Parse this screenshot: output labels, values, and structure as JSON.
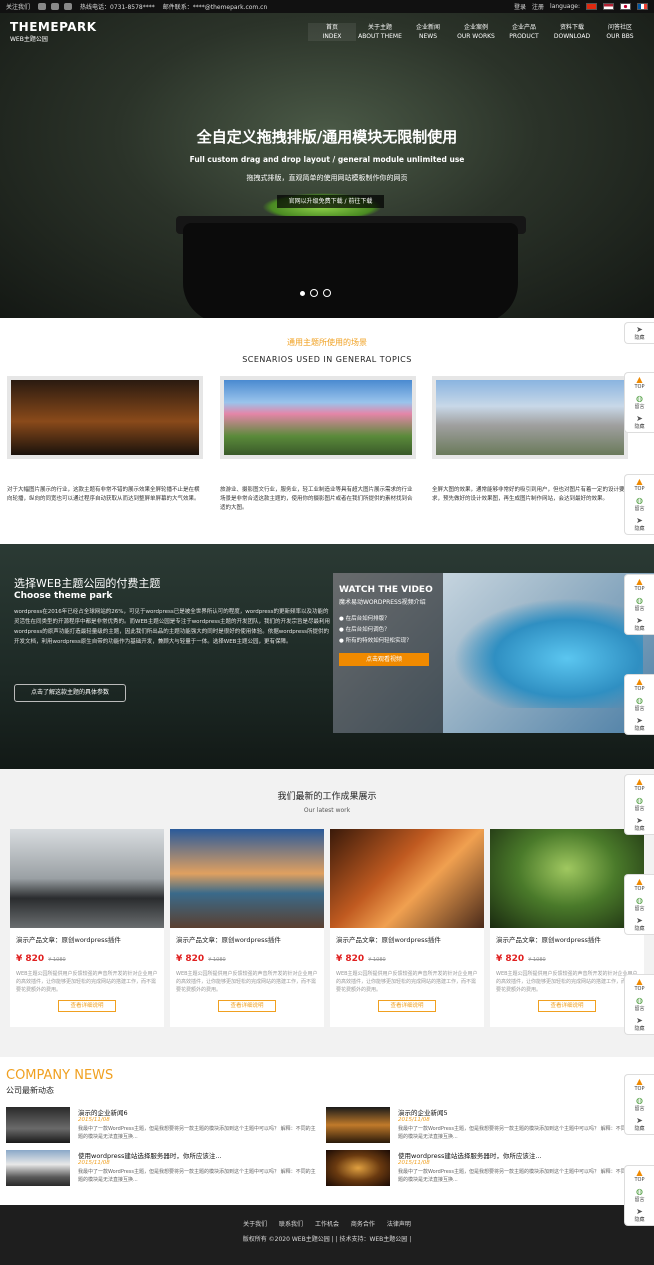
{
  "topbar": {
    "follow": "关注我们",
    "hotline": "热线电话：0731-8578****",
    "email": "邮件联系：****@themepark.com.cn",
    "login": "登录",
    "register": "注册",
    "language": "language:"
  },
  "header": {
    "logo_main": "THEMEPARK",
    "logo_sub": "WEB主题公园",
    "nav": [
      {
        "cn": "首页",
        "en": "INDEX"
      },
      {
        "cn": "关于主题",
        "en": "ABOUT THEME"
      },
      {
        "cn": "企业新闻",
        "en": "NEWS"
      },
      {
        "cn": "企业案例",
        "en": "OUR WORKS"
      },
      {
        "cn": "企业产品",
        "en": "PRODUCT"
      },
      {
        "cn": "资料下载",
        "en": "DOWNLOAD"
      },
      {
        "cn": "问答社区",
        "en": "OUR BBS"
      }
    ]
  },
  "hero": {
    "title": "全自定义拖拽排版/通用模块无限制使用",
    "subtitle_en": "Full custom drag and drop layout / general module unlimited use",
    "subtitle_cn": "拖拽式排版，直观简单的使用网站模板制作你的网页",
    "button": "官网以升级免费下载 / 前往下载"
  },
  "scenarios": {
    "title": "通用主题所使用的场景",
    "subtitle": "SCENARIOS USED IN GENERAL TOPICS",
    "cards": [
      {
        "text": "对于大幅图片展示的行业，这款主题有非常不错的展示效果全屏轮播不止是在横向轮播，纵向的同宽也可以通过程序自动获取从而达到整屏单屏幕的大气效果。"
      },
      {
        "text": "旅游业、摄影图文行业，服务业，轻工业制造业等具有超大图片展示需求的行业场景是非常合适这款主题的，使用你的摄影图片或者在我们所提供的素材找到合适的大图。"
      },
      {
        "text": "全屏大图的效果，通常能够非常好的吸引到用户，但也对图片有着一定的设计要求，预先做好的设计效果图，再生成图片制作网站，会达到最好的效果。"
      }
    ]
  },
  "choose": {
    "title": "选择WEB主题公园的付费主题",
    "subtitle": "Choose theme park",
    "desc": "wordpress在2016年已经占全球网站的26%，可见于wordpress已是被全世界所认可的程度，wordpress的更新频率以及功能的灵活性在同类型的开源程序中都是非常优秀的。而WEB主题公园是专注于wordpress主题的开发团队，我们的开发宗旨是尽最利用wordpress的原声功能打造最轻量级的主题，因此我们所出品的主题功能强大的同时是很好的使用体验。依据wordpress所提供的开发文档，利用wordpress原生自带的功能作为基础开发，兼顾大与轻量于一体。选择WEB主题公园，更有保障。",
    "button": "点击了解这款主题的具体参数",
    "video": {
      "title": "WATCH THE VIDEO",
      "subtitle": "魔术易动WORDPRESS视频介绍",
      "items": [
        "在后台如何排版？",
        "在后台如何调色？",
        "所有的特效如何轻松实现？"
      ],
      "button": "点击观看视频"
    }
  },
  "latest": {
    "title": "我们最新的工作成果展示",
    "subtitle": "Our latest work",
    "cards": [
      {
        "name": "演示产品文章：原创wordpress插件",
        "price": "¥ 820",
        "old": "¥ 1080",
        "desc": "WEB主题公园所提供用户反馈较强的声音所开发的针对企业用户的高效插件，让你能够更加轻松的完成网站的搭建工作，而不需要花费额外的费用。",
        "button": "查看详细说明"
      },
      {
        "name": "演示产品文章：原创wordpress插件",
        "price": "¥ 820",
        "old": "¥ 1080",
        "desc": "WEB主题公园所提供用户反馈较强的声音所开发的针对企业用户的高效插件，让你能够更加轻松的完成网站的搭建工作，而不需要花费额外的费用。",
        "button": "查看详细说明"
      },
      {
        "name": "演示产品文章：原创wordpress插件",
        "price": "¥ 820",
        "old": "¥ 1080",
        "desc": "WEB主题公园所提供用户反馈较强的声音所开发的针对企业用户的高效插件，让你能够更加轻松的完成网站的搭建工作，而不需要花费额外的费用。",
        "button": "查看详细说明"
      },
      {
        "name": "演示产品文章：原创wordpress插件",
        "price": "¥ 820",
        "old": "¥ 1080",
        "desc": "WEB主题公园所提供用户反馈较强的声音所开发的针对企业用户的高效插件，让你能够更加轻松的完成网站的搭建工作，而不需要花费额外的费用。",
        "button": "查看详细说明"
      }
    ]
  },
  "news": {
    "title": "COMPANY NEWS",
    "subtitle": "公司最新动态",
    "items": [
      {
        "title": "演示的企业新闻6",
        "date": "2015/11/08",
        "summary": "我最中了一款WordPress主题，但是我想要将另一款主题的模块添加到这个主题中可以吗？ 解释：不同的主题的模块是无法直接互换..."
      },
      {
        "title": "演示的企业新闻5",
        "date": "2015/11/08",
        "summary": "我最中了一款WordPress主题，但是我想要将另一款主题的模块添加到这个主题中可以吗？ 解释：不同的主题的模块是无法直接互换..."
      },
      {
        "title": "使用wordpress建站选择服务器时，你所应该注...",
        "date": "2015/11/08",
        "summary": "我最中了一款WordPress主题，但是我想要将另一款主题的模块添加到这个主题中可以吗？ 解释：不同的主题的模块是无法直接互换..."
      },
      {
        "title": "使用wordpress建站选择服务器时，你所应该注...",
        "date": "2015/11/08",
        "summary": "我最中了一款WordPress主题，但是我想要将另一款主题的模块添加到这个主题中可以吗？ 解释：不同的主题的模块是无法直接互换..."
      }
    ]
  },
  "footer": {
    "links": [
      "关于我们",
      "联系我们",
      "工作机会",
      "商务合作",
      "法律声明"
    ],
    "copyright": "版权所有 ©2020 WEB主题公园 | | 技术支持：WEB主题公园 |"
  },
  "side": {
    "top": "TOP",
    "comment": "留言",
    "hide": "隐藏"
  },
  "colors": {
    "accent": "#f0a020",
    "price": "#e02020",
    "video_button": "#f08a00",
    "footer_bg": "#1e1e1e"
  }
}
